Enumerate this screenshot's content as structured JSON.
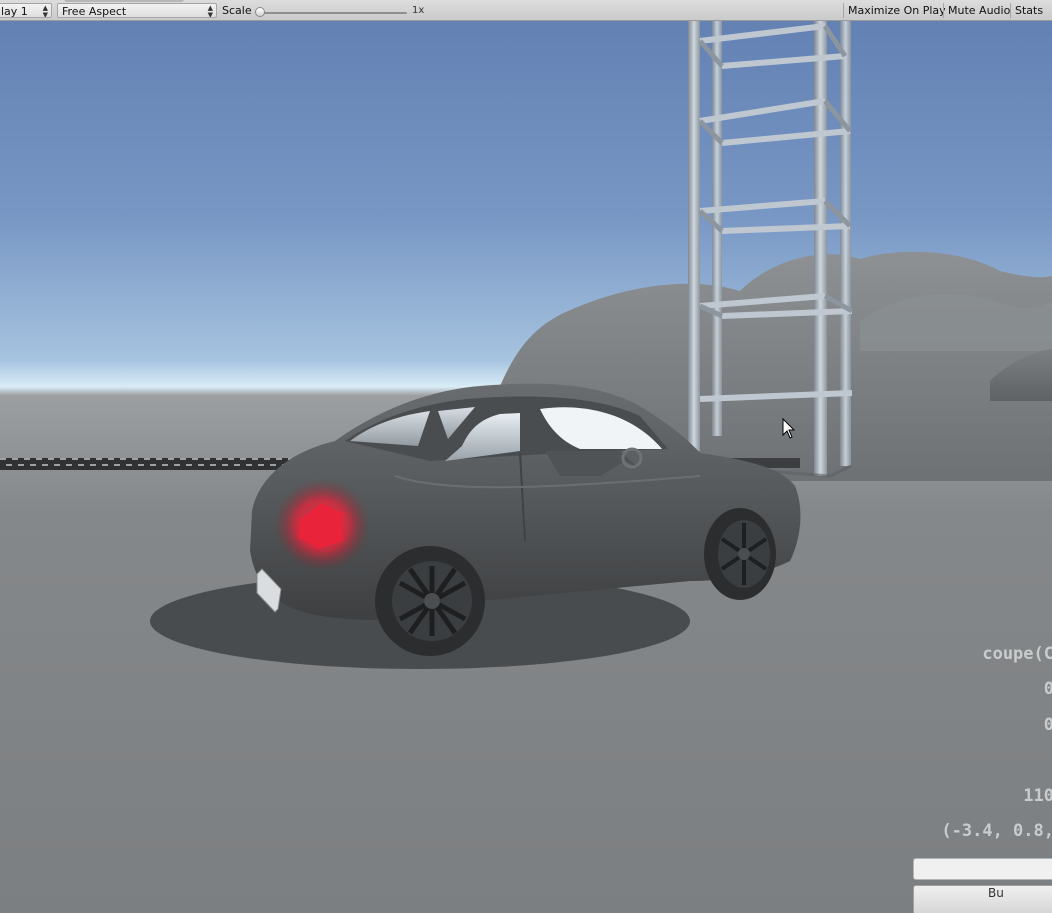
{
  "toolbar": {
    "display_label": "lay 1",
    "aspect_label": "Free Aspect",
    "scale_label": "Scale",
    "scale_value": "1x",
    "scale_slider_level": 0.0,
    "maximize_label": "Maximize On Play",
    "mute_label": "Mute Audio",
    "stats_label": "Stats"
  },
  "overlay": {
    "line1": "coupe(C",
    "line2": "0",
    "line3": "0",
    "line4": "110",
    "line5": "(-3.4, 0.8,"
  },
  "panel": {
    "button_label": "Bu"
  },
  "colors": {
    "sky_top": "#6381b3",
    "horizon": "#d9ecf7",
    "ground": "#7c7f81",
    "car_body": "#55585a",
    "tail_light": "#e8233a",
    "tower_metal": "#a9b3bd"
  },
  "icons": {
    "cursor": "mouse-pointer-icon",
    "dropdown": "updown-arrows-icon"
  }
}
